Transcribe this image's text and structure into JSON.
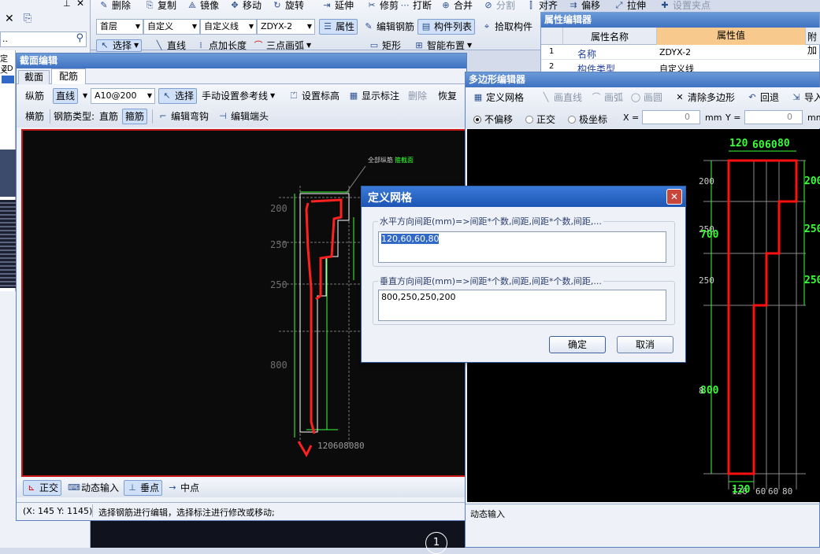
{
  "colors": {
    "accent": "#3f72c2",
    "drawing_bg": "#0b0b0b",
    "dark_bg": "#1d2233",
    "rebar": "#ff2020",
    "dim_green": "#39ff39",
    "selection": "#3169c6"
  },
  "left_strip": {
    "close_glyph": "✕",
    "copy_glyph": "⎘",
    "row_dots": "..",
    "row_a": "定义",
    "row_b": "ZD"
  },
  "top_toolbar": {
    "row1": [
      {
        "label": "删除",
        "icon": "✎"
      },
      {
        "label": "复制",
        "icon": "⎘"
      },
      {
        "label": "镜像",
        "icon": "⟁"
      },
      {
        "label": "移动",
        "icon": "✥"
      },
      {
        "label": "旋转",
        "icon": "↻"
      },
      {
        "label": "延伸",
        "icon": "⇥"
      },
      {
        "label": "修剪",
        "icon": "✂"
      },
      {
        "label": "打断",
        "icon": "⋯"
      },
      {
        "label": "合并",
        "icon": "⊕"
      },
      {
        "label": "分割",
        "icon": "⊘"
      },
      {
        "label": "对齐",
        "icon": "⫿"
      },
      {
        "label": "偏移",
        "icon": "⇉"
      },
      {
        "label": "拉伸",
        "icon": "⤢"
      },
      {
        "label": "设置夹点",
        "icon": "✚"
      }
    ],
    "floor": "首层",
    "category": "自定义",
    "type": "自定义线",
    "component": "ZDYX-2",
    "row2_buttons": [
      {
        "label": "属性",
        "icon": "☰"
      },
      {
        "label": "编辑钢筋",
        "icon": "✎"
      },
      {
        "label": "构件列表",
        "icon": "▤"
      },
      {
        "label": "拾取构件",
        "icon": "⌖"
      }
    ],
    "row3": {
      "select": "选择",
      "line": "直线",
      "point_length": "点加长度",
      "arc": "三点画弧",
      "rect": "矩形",
      "smart": "智能布置"
    }
  },
  "property_editor": {
    "title": "属性编辑器",
    "headers": [
      "属性名称",
      "属性值",
      "附加"
    ],
    "rows": [
      {
        "no": "1",
        "name": "名称",
        "value": "ZDYX-2"
      },
      {
        "no": "2",
        "name": "构件类型",
        "value": "自定义线"
      }
    ]
  },
  "section_editor": {
    "title": "截面编辑",
    "tabs": [
      "截面",
      "配筋"
    ],
    "toolbar1": {
      "long_bar": "纵筋",
      "line": "直线",
      "rebar_spec": "A10@200",
      "select": "选择",
      "ref_line": "手动设置参考线",
      "set_elev": "设置标高",
      "show_dim": "显示标注",
      "delete": "删除",
      "restore": "恢复"
    },
    "toolbar2": {
      "hbar": "横筋",
      "bar_type_label": "钢筋类型:",
      "straight": "直筋",
      "stirrup": "箍筋",
      "edit_hook": "编辑弯钩",
      "edit_end": "编辑端头"
    },
    "canvas_labels": {
      "legend_a": "全部纵筋",
      "legend_b": "箍截面",
      "dims": [
        "200",
        "250",
        "250",
        "800"
      ],
      "bottom_dims": "120608080"
    },
    "bottom": {
      "ortho": "正交",
      "dynamic": "动态输入",
      "perp": "垂点",
      "mid": "中点"
    },
    "status": {
      "coords": "(X: 145 Y: 1145)",
      "message": "选择钢筋进行编辑，选择标注进行修改或移动;"
    }
  },
  "polygon_editor": {
    "title": "多边形编辑器",
    "toolbar": {
      "grid": "定义网格",
      "line": "画直线",
      "arc": "画弧",
      "circle": "画圆",
      "clear": "清除多边形",
      "undo": "回退",
      "import": "导入"
    },
    "options": {
      "no_offset": "不偏移",
      "ortho": "正交",
      "polar": "极坐标",
      "x_label": "X =",
      "x_value": "0",
      "y_label": "Y =",
      "y_value": "0",
      "unit": "mm"
    },
    "top_dims": [
      "120",
      "60",
      "60",
      "80"
    ],
    "bottom_dims": [
      "120",
      "60",
      "60",
      "80"
    ],
    "left_dims": [
      "200",
      "250",
      "250",
      "800"
    ],
    "left_big": [
      "700",
      "800"
    ],
    "right_dims": [
      "200",
      "250",
      "250"
    ],
    "status": "动态输入"
  },
  "dialog": {
    "title": "定义网格",
    "h_group": "水平方向间距(mm)=>间距*个数,间距,间距*个数,间距,...",
    "h_value": "120,60,60,80",
    "v_group": "垂直方向间距(mm)=>间距*个数,间距,间距*个数,间距,...",
    "v_value": "800,250,250,200",
    "ok": "确定",
    "cancel": "取消",
    "close_glyph": "✕"
  },
  "axis_marker": "1"
}
